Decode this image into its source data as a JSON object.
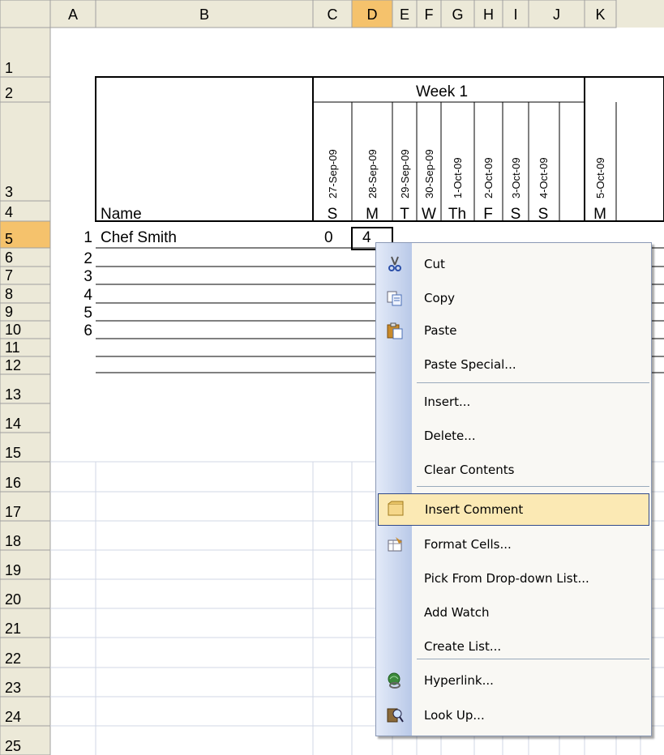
{
  "columns": [
    "A",
    "B",
    "C",
    "D",
    "E",
    "F",
    "G",
    "H",
    "I",
    "J",
    "K"
  ],
  "active_column": "D",
  "active_row": "5",
  "rows": [
    "1",
    "2",
    "3",
    "4",
    "5",
    "6",
    "7",
    "8",
    "9",
    "10",
    "11",
    "12",
    "13",
    "14",
    "15",
    "16",
    "17",
    "18",
    "19",
    "20",
    "21",
    "22",
    "23",
    "24",
    "25"
  ],
  "week_label": "Week 1",
  "dates": [
    "27-Sep-09",
    "28-Sep-09",
    "29-Sep-09",
    "30-Sep-09",
    "1-Oct-09",
    "2-Oct-09",
    "3-Oct-09",
    "4-Oct-09",
    "5-Oct-09"
  ],
  "days": [
    "S",
    "M",
    "T",
    "W",
    "Th",
    "F",
    "S",
    "S",
    "M"
  ],
  "name_header": "Name",
  "row_numbers": [
    "1",
    "2",
    "3",
    "4",
    "5",
    "6"
  ],
  "chef_name": "Chef Smith",
  "cell_c5": "0",
  "cell_d5": "4",
  "colors": {
    "header_bg": "#ece9d8",
    "active_header": "#f5c26c",
    "grid": "#d0d7e5",
    "menu_highlight": "#fbe9b4"
  },
  "context_menu": {
    "items": [
      {
        "label": "Cut",
        "icon": "scissors-icon"
      },
      {
        "label": "Copy",
        "icon": "copy-icon"
      },
      {
        "label": "Paste",
        "icon": "paste-icon"
      },
      {
        "label": "Paste Special...",
        "icon": ""
      },
      {
        "label": "Insert...",
        "icon": ""
      },
      {
        "label": "Delete...",
        "icon": ""
      },
      {
        "label": "Clear Contents",
        "icon": ""
      },
      {
        "label": "Insert Comment",
        "icon": "comment-icon",
        "highlighted": true
      },
      {
        "label": "Format Cells...",
        "icon": "format-cells-icon"
      },
      {
        "label": "Pick From Drop-down List...",
        "icon": ""
      },
      {
        "label": "Add Watch",
        "icon": ""
      },
      {
        "label": "Create List...",
        "icon": ""
      },
      {
        "label": "Hyperlink...",
        "icon": "hyperlink-icon"
      },
      {
        "label": "Look Up...",
        "icon": "lookup-icon"
      }
    ]
  }
}
